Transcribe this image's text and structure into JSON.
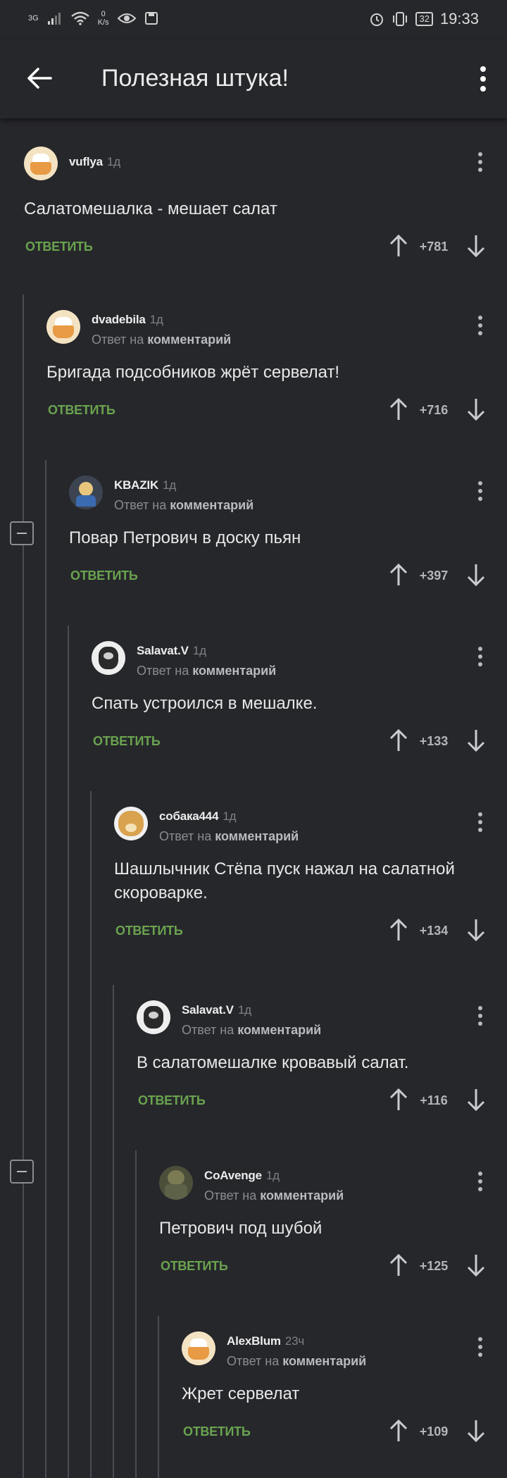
{
  "status_bar": {
    "network": "3G",
    "speed_value": "0",
    "speed_unit": "K/s",
    "battery": "32",
    "time": "19:33"
  },
  "app_bar": {
    "title": "Полезная штука!"
  },
  "reply_label": "ОТВЕТИТЬ",
  "reply_to_prefix": "Ответ на",
  "reply_to_link": "комментарий",
  "colors": {
    "background": "#26272b",
    "reply": "#6aa34f",
    "thread_line": "#4a4c52"
  },
  "comments": [
    {
      "author": "vuflya",
      "time": "1д",
      "text": "Салатомешалка - мешает салат",
      "score": "+781",
      "avatar_icon": "chef-avatar-icon",
      "is_reply": false
    },
    {
      "author": "dvadebila",
      "time": "1д",
      "text": "Бригада подсобников жрёт сервелат!",
      "score": "+716",
      "avatar_icon": "chef-avatar-icon",
      "is_reply": true
    },
    {
      "author": "KBAZIK",
      "time": "1д",
      "text": "Повар Петрович в доску пьян",
      "score": "+397",
      "avatar_icon": "vault-boy-avatar-icon",
      "is_reply": true
    },
    {
      "author": "Salavat.V",
      "time": "1д",
      "text": "Спать устроился в мешалке.",
      "score": "+133",
      "avatar_icon": "portrait-avatar-icon",
      "is_reply": true
    },
    {
      "author": "собака444",
      "time": "1д",
      "text": "Шашлычник Стёпа пуск нажал на салатной скороварке.",
      "score": "+134",
      "avatar_icon": "doge-avatar-icon",
      "is_reply": true
    },
    {
      "author": "Salavat.V",
      "time": "1д",
      "text": "В салатомешалке кровавый салат.",
      "score": "+116",
      "avatar_icon": "portrait-avatar-icon",
      "is_reply": true
    },
    {
      "author": "CoAvenge",
      "time": "1д",
      "text": "Петрович под шубой",
      "score": "+125",
      "avatar_icon": "soldier-avatar-icon",
      "is_reply": true
    },
    {
      "author": "AlexBlum",
      "time": "23ч",
      "text": "Жрет сервелат",
      "score": "+109",
      "avatar_icon": "chef-avatar-icon",
      "is_reply": true
    }
  ]
}
